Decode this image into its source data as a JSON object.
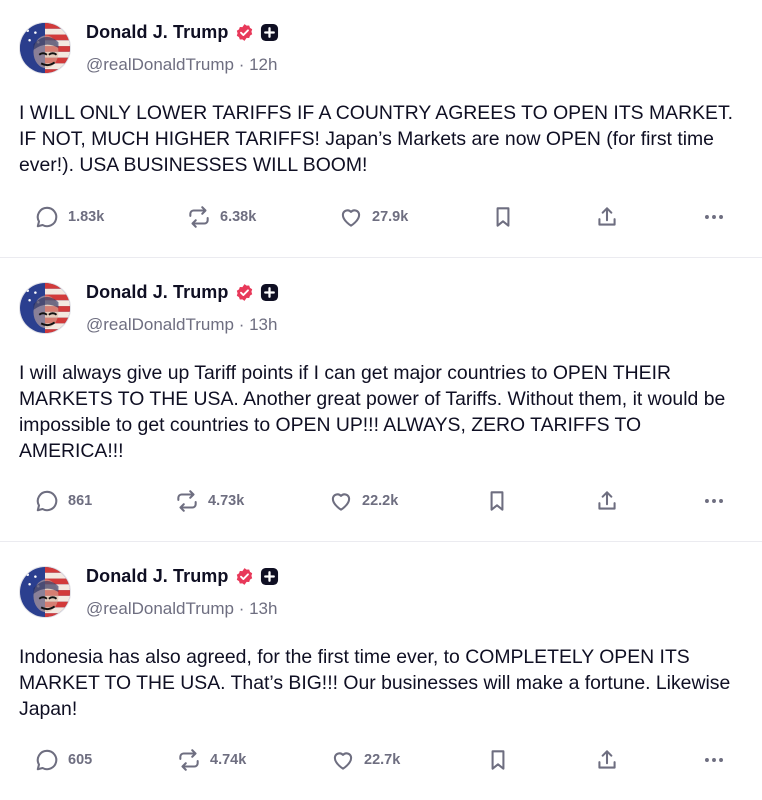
{
  "posts": [
    {
      "author": {
        "name": "Donald J. Trump",
        "handle": "@realDonaldTrump",
        "time": "12h"
      },
      "text": "I WILL ONLY LOWER TARIFFS IF A COUNTRY AGREES TO OPEN ITS MARKET. IF NOT, MUCH HIGHER TARIFFS! Japan’s Markets are now OPEN (for first time ever!). USA BUSINESSES WILL BOOM!",
      "replies": "1.83k",
      "reposts": "6.38k",
      "likes": "27.9k"
    },
    {
      "author": {
        "name": "Donald J. Trump",
        "handle": "@realDonaldTrump",
        "time": "13h"
      },
      "text": "I will always give up Tariff points if I can get major countries to OPEN THEIR MARKETS TO THE USA. Another great power of Tariffs. Without them, it would be impossible to get countries to OPEN UP!!! ALWAYS, ZERO TARIFFS TO AMERICA!!!",
      "replies": "861",
      "reposts": "4.73k",
      "likes": "22.2k"
    },
    {
      "author": {
        "name": "Donald J. Trump",
        "handle": "@realDonaldTrump",
        "time": "13h"
      },
      "text": "Indonesia has also agreed, for the first time ever, to COMPLETELY OPEN ITS MARKET TO THE USA. That’s BIG!!! Our businesses will make a fortune. Likewise Japan!",
      "replies": "605",
      "reposts": "4.74k",
      "likes": "22.7k"
    }
  ],
  "separator": " · ",
  "icons": {
    "verified": "verified-badge-icon",
    "plus": "plus-badge-icon",
    "reply": "reply-icon",
    "repost": "repost-icon",
    "like": "heart-icon",
    "bookmark": "bookmark-icon",
    "share": "share-icon",
    "more": "more-icon"
  },
  "colors": {
    "text": "#0f0f23",
    "muted": "#6e6e80",
    "verified": "#e8395a",
    "separator": "#ebebf0"
  }
}
